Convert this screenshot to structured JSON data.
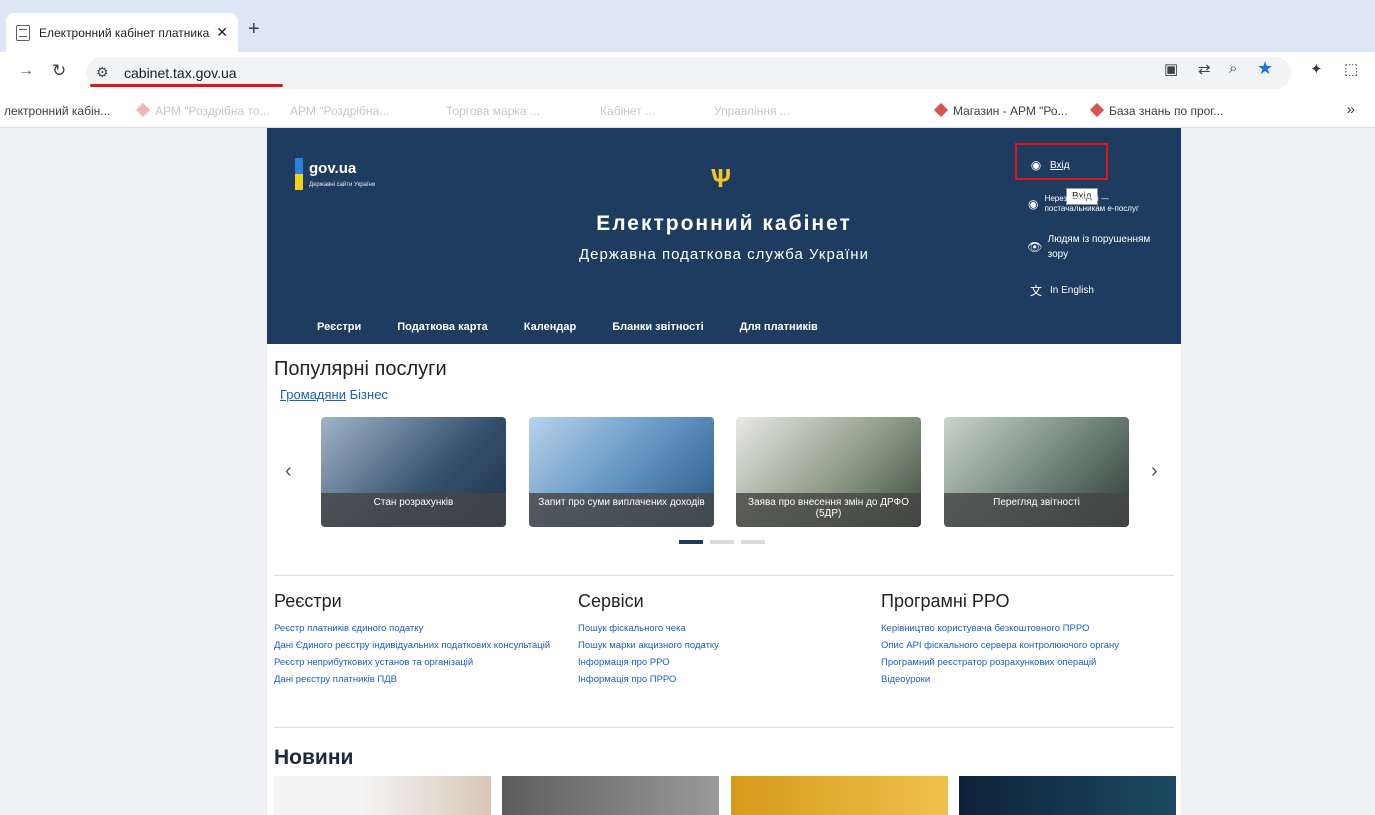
{
  "browser": {
    "tab_title": "Електронний кабінет платника",
    "tab_close": "✕",
    "new_tab": "+",
    "url": "cabinet.tax.gov.ua",
    "bookmarks": [
      {
        "label": "лектронний кабін..."
      },
      {
        "label": "АРМ \"Роздрібна то..."
      },
      {
        "label": "АРМ \"Роздрібна..."
      },
      {
        "label": "Торгова марка ..."
      },
      {
        "label": "Кабінет ..."
      },
      {
        "label": "Управління ..."
      },
      {
        "label": "Магазин - АРМ \"Ро..."
      },
      {
        "label": "База знань по прог..."
      }
    ],
    "bookmarks_more": "»"
  },
  "header": {
    "gov_name": "gov.ua",
    "gov_sub": "Державні сайти України",
    "title": "Електронний кабінет",
    "subtitle": "Державна податкова служба України",
    "login": "Вхід",
    "login_tooltip": "Вхід",
    "nonresident": "Нерезидентам — постачальникам е-послуг",
    "vision": "Людям із порушенням зору",
    "english": "In English"
  },
  "menu": [
    "Реєстри",
    "Податкова карта",
    "Календар",
    "Бланки звітності",
    "Для платників"
  ],
  "popular": {
    "title": "Популярні послуги",
    "tab_citizens": "Громадяни",
    "tab_business": "Бізнес",
    "cards": [
      "Стан розрахунків",
      "Запит про суми виплачених доходів",
      "Заява про внесення змін до ДРФО (5ДР)",
      "Перегляд звітності"
    ]
  },
  "registries": {
    "title": "Реєстри",
    "links": [
      "Реєстр платників єдиного податку",
      "Дані Єдиного реєстру індивідуальних податкових консультацій",
      "Реєстр неприбуткових установ та організацій",
      "Дані реєстру платників ПДВ"
    ]
  },
  "services": {
    "title": "Сервіси",
    "links": [
      "Пошук фіскального чека",
      "Пошук марки акцизного податку",
      "Інформація про РРО",
      "Інформація про ПРРО"
    ]
  },
  "prro": {
    "title": "Програмні РРО",
    "links": [
      "Керівництво користувача безкоштовного ПРРО",
      "Опис API фіскального сервера контролюючого органу",
      "Програмний реєстратор розрахункових операцій",
      "Відеоуроки"
    ]
  },
  "news": {
    "title": "Новини"
  }
}
